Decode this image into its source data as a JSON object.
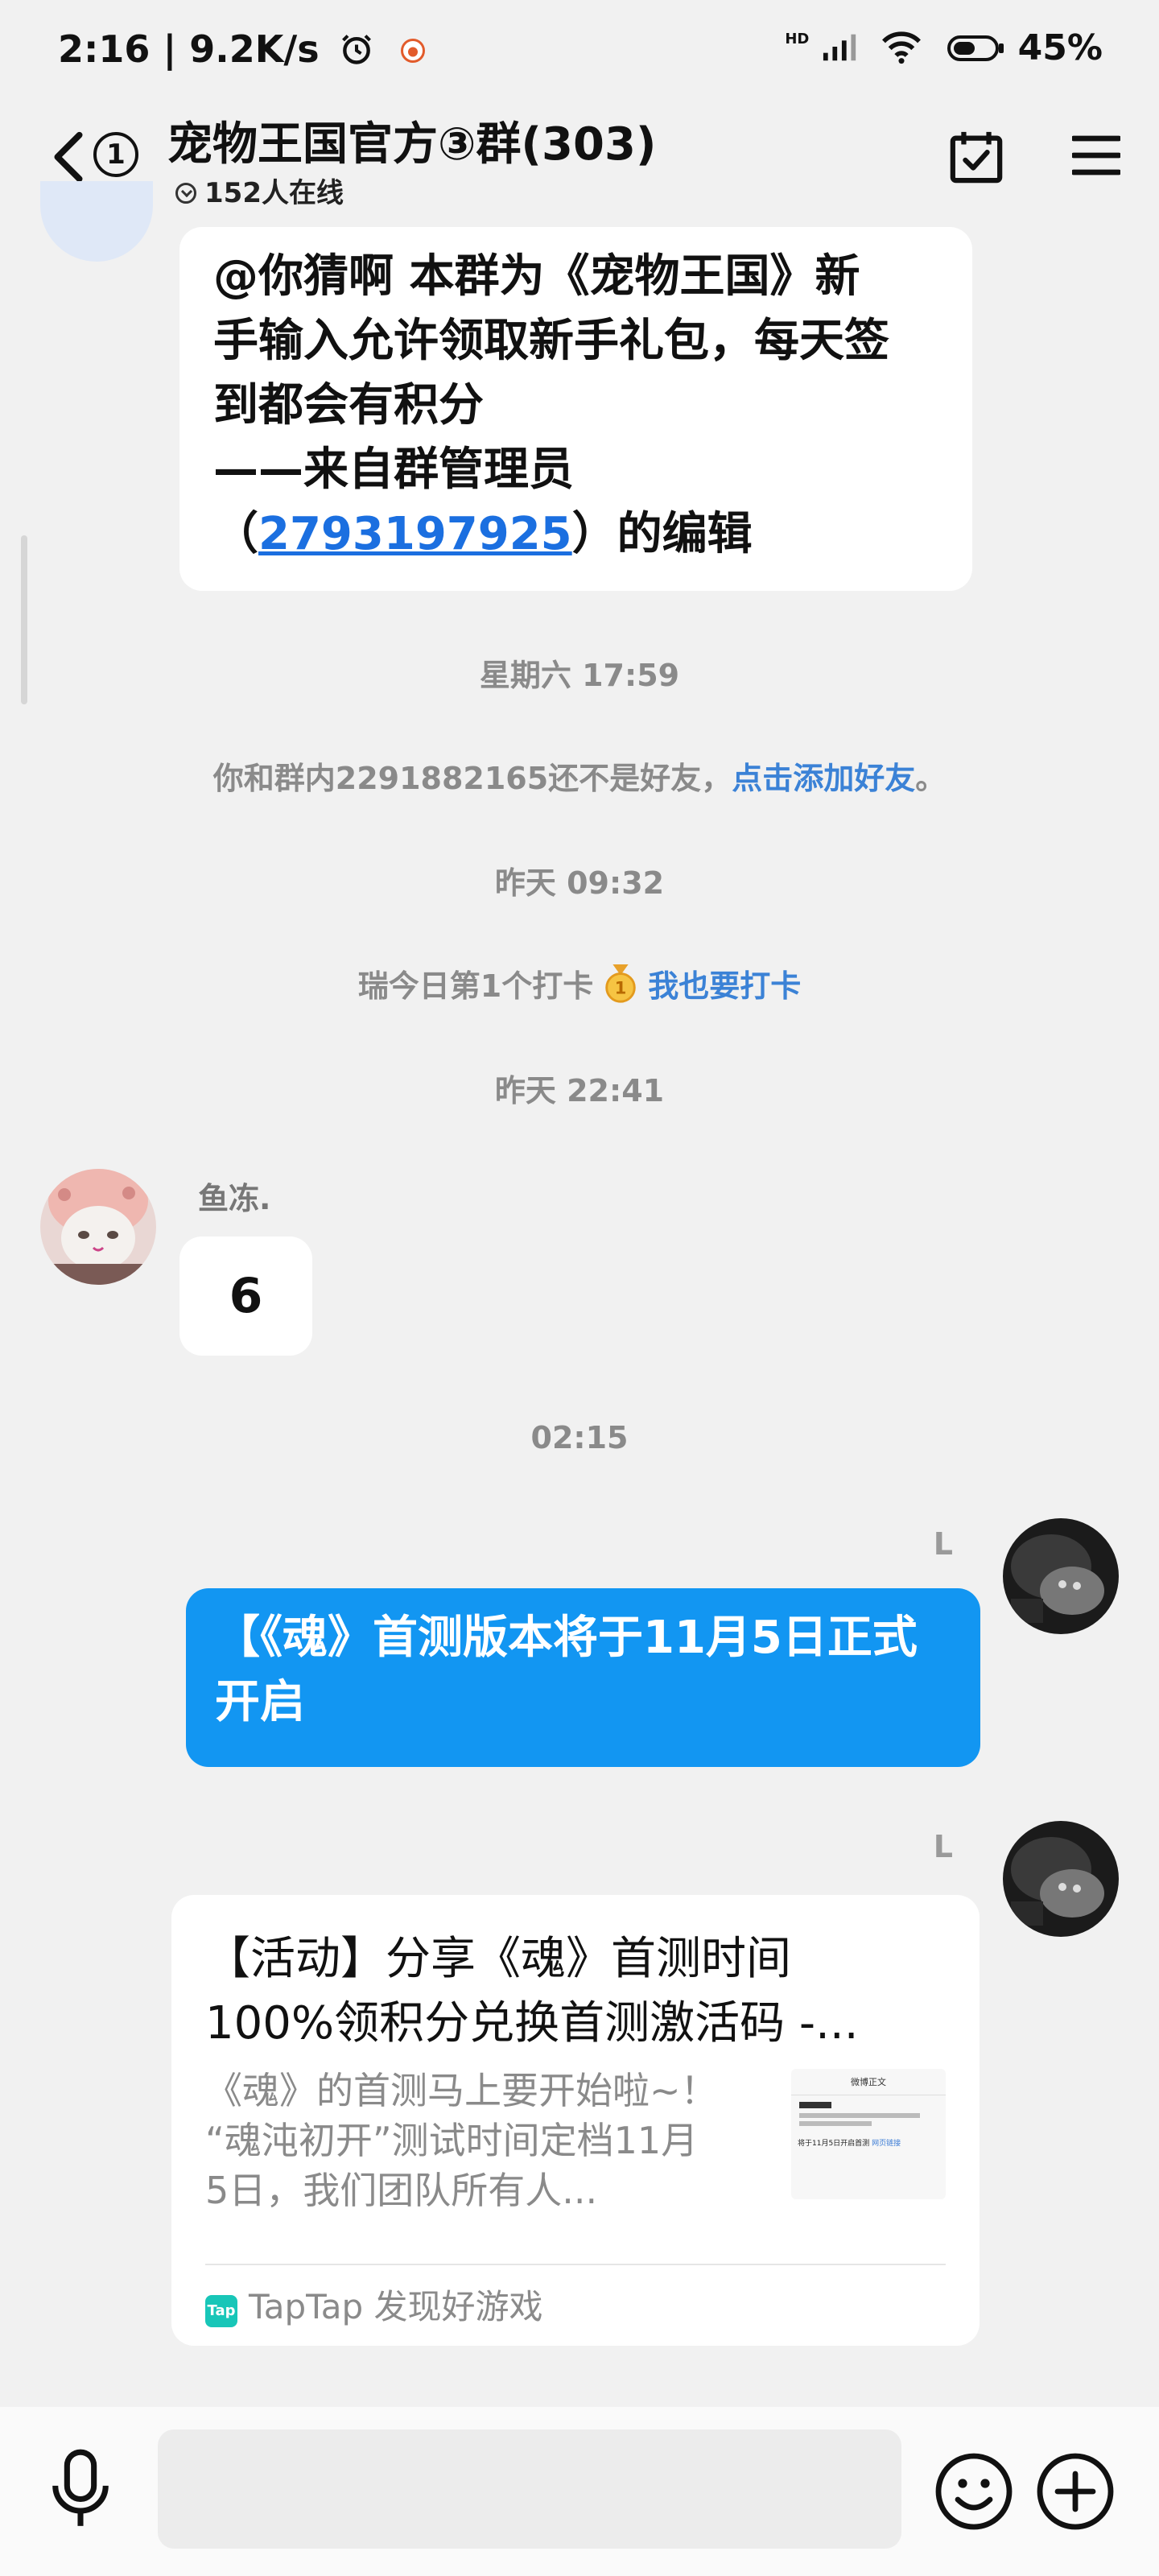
{
  "status_bar": {
    "time": "2:16",
    "speed": "9.2K/s",
    "network": "HD",
    "battery": "45%"
  },
  "header": {
    "unread_count": "1",
    "title": "宠物王国官方③群(303)",
    "online": "152人在线"
  },
  "messages": {
    "announcement": {
      "line1": "@你猜啊 本群为《宠物王国》新",
      "line2": "手输入允许领取新手礼包，每天签",
      "line3": "到都会有积分",
      "line4": "——来自群管理员",
      "line5_open": "（",
      "line5_link": "2793197925",
      "line5_close": "）的编辑"
    },
    "time1": "星期六 17:59",
    "friend_notice_text": "你和群内2291882165还不是好友，",
    "friend_notice_link": "点击添加好友",
    "friend_notice_end": "。",
    "time2": "昨天 09:32",
    "checkin_text": "瑞今日第1个打卡",
    "checkin_link": "我也要打卡",
    "time3": "昨天 22:41",
    "sender1": "鱼冻.",
    "msg_six": "6",
    "time4": "02:15",
    "sender2": "L",
    "blue_line1": "【《魂》首测版本将于11月5日正式",
    "blue_line2": "开启",
    "sender3": "L",
    "card": {
      "title_line1": "【活动】分享《魂》首测时间",
      "title_line2": "100%领积分兑换首测激活码 -...",
      "desc_line1": "《魂》的首测马上要开始啦~！",
      "desc_line2": "“魂沌初开”测试时间定档11月",
      "desc_line3": "5日，我们团队所有人...",
      "source_icon": "Tap",
      "source": "TapTap 发现好游戏",
      "thumb_title": "微博正文",
      "thumb_line": "将于11月5日开启首测",
      "thumb_link": "网页链接"
    }
  },
  "input": {
    "placeholder": ""
  }
}
